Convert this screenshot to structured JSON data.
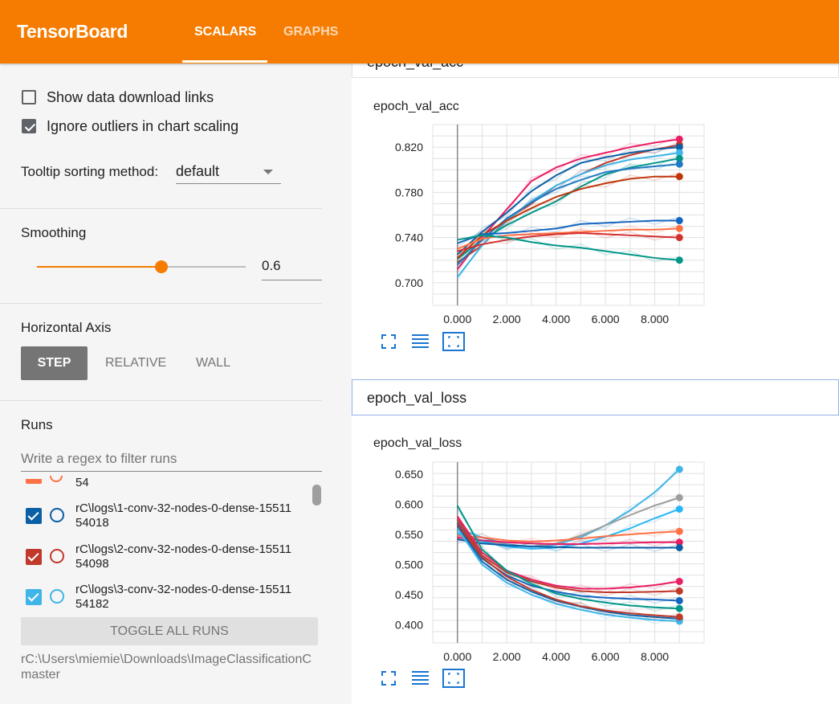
{
  "header": {
    "brand": "TensorBoard",
    "tabs": [
      {
        "label": "SCALARS",
        "active": true
      },
      {
        "label": "GRAPHS",
        "active": false
      }
    ],
    "accent": "#f57c00"
  },
  "sidebar": {
    "show_download_links": {
      "label": "Show data download links",
      "checked": false
    },
    "ignore_outliers": {
      "label": "Ignore outliers in chart scaling",
      "checked": true
    },
    "tooltip_sorting": {
      "label": "Tooltip sorting method:",
      "value": "default"
    },
    "smoothing": {
      "label": "Smoothing",
      "value": "0.6",
      "level": 0.6
    },
    "horizontal_axis": {
      "label": "Horizontal Axis",
      "options": [
        "STEP",
        "RELATIVE",
        "WALL"
      ],
      "selected": "STEP"
    },
    "runs": {
      "label": "Runs",
      "filter_placeholder": "Write a regex to filter runs",
      "partial_item": "54",
      "items": [
        {
          "line1": "rC\\logs\\1-conv-32-nodes-0-dense-15511",
          "line2": "54018",
          "color": "#0b5fa5",
          "checked": true
        },
        {
          "line1": "rC\\logs\\2-conv-32-nodes-0-dense-15511",
          "line2": "54098",
          "color": "#c0392b",
          "checked": true
        },
        {
          "line1": "rC\\logs\\3-conv-32-nodes-0-dense-15511",
          "line2": "54182",
          "color": "#3fb5e8",
          "checked": true
        }
      ],
      "toggle_all": "TOGGLE ALL RUNS",
      "path_line1": "rC:\\Users\\miemie\\Downloads\\ImageClassificationC",
      "path_line2": "master"
    }
  },
  "main": {
    "sections": [
      {
        "title": "epoch_val_acc"
      },
      {
        "title": "epoch_val_loss"
      }
    ],
    "cards": [
      {
        "title": "epoch_val_acc"
      },
      {
        "title": "epoch_val_loss"
      }
    ]
  },
  "chart_data": [
    {
      "type": "line",
      "title": "epoch_val_acc",
      "xlabel": "",
      "ylabel": "",
      "x_ticks": [
        "0.000",
        "2.000",
        "4.000",
        "6.000",
        "8.000"
      ],
      "y_ticks": [
        "0.700",
        "0.740",
        "0.780",
        "0.820"
      ],
      "xlim": [
        -1,
        10
      ],
      "ylim": [
        0.68,
        0.84
      ],
      "grid": true,
      "x": [
        0,
        1,
        2,
        3,
        4,
        5,
        6,
        7,
        8,
        9
      ],
      "series": [
        {
          "color": "#e91e63",
          "values": [
            0.712,
            0.74,
            0.765,
            0.79,
            0.802,
            0.81,
            0.815,
            0.82,
            0.824,
            0.827
          ]
        },
        {
          "color": "#c0392b",
          "values": [
            0.718,
            0.733,
            0.756,
            0.77,
            0.786,
            0.796,
            0.806,
            0.813,
            0.818,
            0.822
          ]
        },
        {
          "color": "#0b5fa5",
          "values": [
            0.725,
            0.745,
            0.762,
            0.781,
            0.795,
            0.806,
            0.811,
            0.815,
            0.818,
            0.82
          ]
        },
        {
          "color": "#3fb5e8",
          "values": [
            0.705,
            0.733,
            0.755,
            0.772,
            0.786,
            0.796,
            0.804,
            0.809,
            0.812,
            0.815
          ]
        },
        {
          "color": "#009688",
          "values": [
            0.721,
            0.738,
            0.751,
            0.762,
            0.772,
            0.785,
            0.796,
            0.802,
            0.806,
            0.81
          ]
        },
        {
          "color": "#1f7ac1",
          "values": [
            0.716,
            0.738,
            0.757,
            0.771,
            0.783,
            0.791,
            0.798,
            0.801,
            0.803,
            0.805
          ]
        },
        {
          "color": "#bf360c",
          "values": [
            0.722,
            0.742,
            0.755,
            0.766,
            0.776,
            0.783,
            0.788,
            0.792,
            0.794,
            0.794
          ]
        },
        {
          "color": "#1565c0",
          "values": [
            0.735,
            0.743,
            0.744,
            0.746,
            0.748,
            0.752,
            0.753,
            0.754,
            0.755,
            0.755
          ]
        },
        {
          "color": "#ff7043",
          "values": [
            0.73,
            0.739,
            0.742,
            0.743,
            0.744,
            0.745,
            0.746,
            0.747,
            0.747,
            0.748
          ]
        },
        {
          "color": "#d32f2f",
          "values": [
            0.728,
            0.734,
            0.738,
            0.741,
            0.743,
            0.744,
            0.743,
            0.742,
            0.741,
            0.74
          ]
        },
        {
          "color": "#009688",
          "values": [
            0.738,
            0.742,
            0.74,
            0.736,
            0.733,
            0.731,
            0.728,
            0.725,
            0.722,
            0.72
          ]
        }
      ]
    },
    {
      "type": "line",
      "title": "epoch_val_loss",
      "xlabel": "",
      "ylabel": "",
      "x_ticks": [
        "0.000",
        "2.000",
        "4.000",
        "6.000",
        "8.000"
      ],
      "y_ticks": [
        "0.400",
        "0.450",
        "0.500",
        "0.550",
        "0.600",
        "0.650"
      ],
      "xlim": [
        -1,
        10
      ],
      "ylim": [
        0.37,
        0.67
      ],
      "grid": true,
      "x": [
        0,
        1,
        2,
        3,
        4,
        5,
        6,
        7,
        8,
        9
      ],
      "series": [
        {
          "color": "#3fb5e8",
          "values": [
            0.56,
            0.545,
            0.534,
            0.529,
            0.533,
            0.545,
            0.565,
            0.59,
            0.62,
            0.658
          ]
        },
        {
          "color": "#9e9e9e",
          "values": [
            0.55,
            0.54,
            0.532,
            0.53,
            0.535,
            0.548,
            0.565,
            0.582,
            0.598,
            0.611
          ]
        },
        {
          "color": "#29b6f6",
          "values": [
            0.552,
            0.538,
            0.53,
            0.526,
            0.528,
            0.535,
            0.546,
            0.56,
            0.577,
            0.592
          ]
        },
        {
          "color": "#ff7043",
          "values": [
            0.548,
            0.545,
            0.54,
            0.538,
            0.54,
            0.543,
            0.547,
            0.55,
            0.553,
            0.555
          ]
        },
        {
          "color": "#e91e63",
          "values": [
            0.545,
            0.54,
            0.537,
            0.535,
            0.534,
            0.534,
            0.535,
            0.536,
            0.537,
            0.537
          ]
        },
        {
          "color": "#0b5fa5",
          "values": [
            0.542,
            0.535,
            0.532,
            0.53,
            0.529,
            0.528,
            0.528,
            0.528,
            0.528,
            0.528
          ]
        },
        {
          "color": "#e91e63",
          "values": [
            0.58,
            0.52,
            0.49,
            0.475,
            0.465,
            0.46,
            0.46,
            0.462,
            0.466,
            0.472
          ]
        },
        {
          "color": "#c0392b",
          "values": [
            0.575,
            0.515,
            0.487,
            0.472,
            0.462,
            0.456,
            0.454,
            0.454,
            0.455,
            0.456
          ]
        },
        {
          "color": "#1565c0",
          "values": [
            0.57,
            0.51,
            0.482,
            0.465,
            0.455,
            0.448,
            0.445,
            0.443,
            0.442,
            0.44
          ]
        },
        {
          "color": "#009688",
          "values": [
            0.598,
            0.525,
            0.49,
            0.468,
            0.452,
            0.443,
            0.437,
            0.432,
            0.429,
            0.427
          ]
        },
        {
          "color": "#0b5fa5",
          "values": [
            0.565,
            0.505,
            0.475,
            0.455,
            0.44,
            0.43,
            0.422,
            0.416,
            0.413,
            0.41
          ]
        },
        {
          "color": "#3fb5e8",
          "values": [
            0.56,
            0.5,
            0.47,
            0.45,
            0.435,
            0.425,
            0.417,
            0.412,
            0.408,
            0.406
          ]
        },
        {
          "color": "#c0392b",
          "values": [
            0.568,
            0.512,
            0.48,
            0.458,
            0.442,
            0.431,
            0.424,
            0.419,
            0.416,
            0.413
          ]
        }
      ]
    }
  ]
}
